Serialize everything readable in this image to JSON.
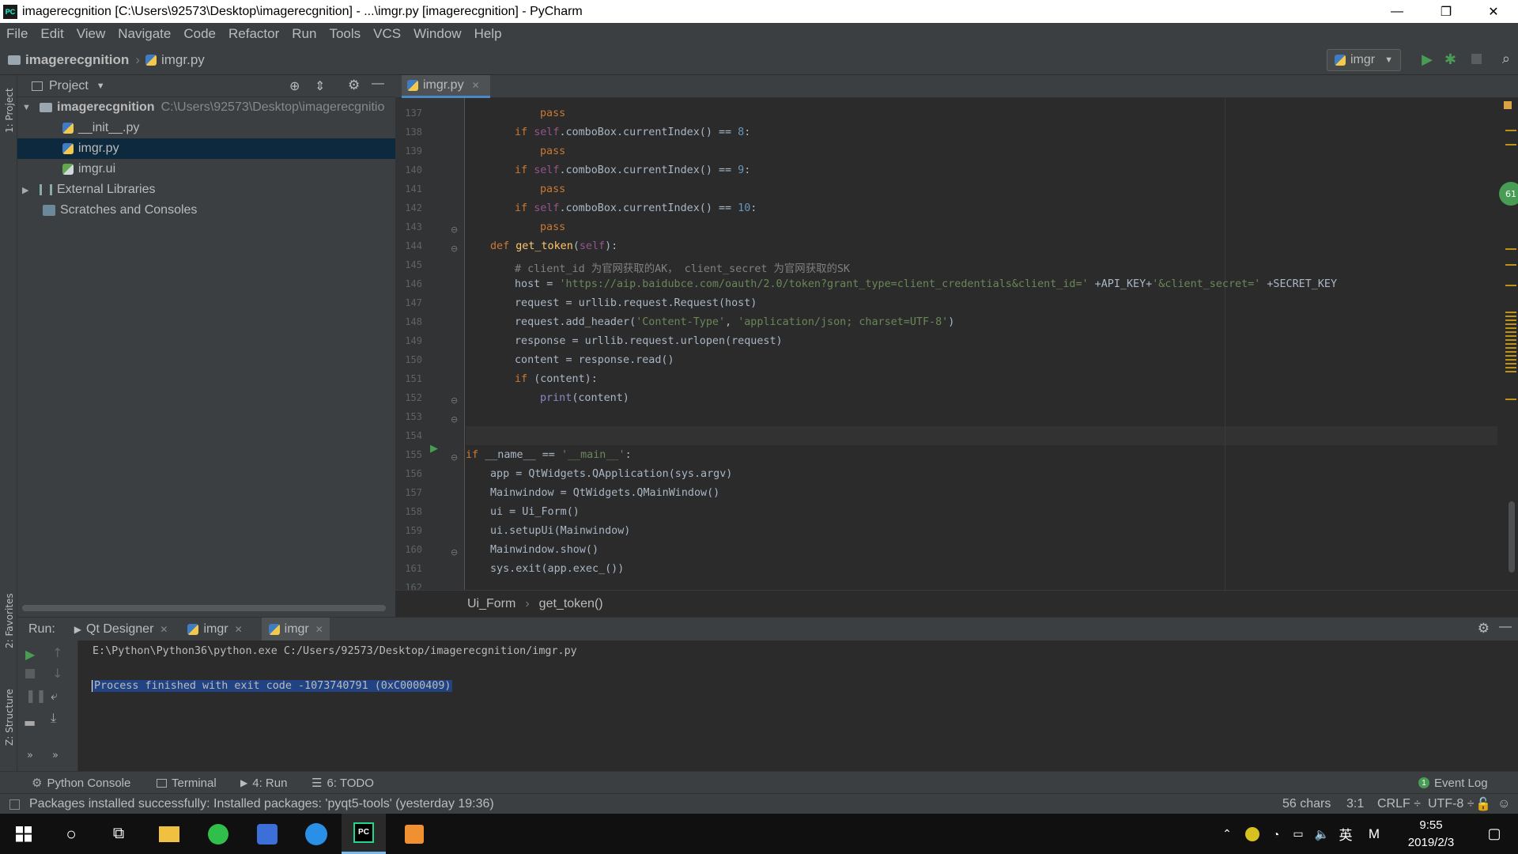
{
  "window": {
    "title": "imagerecgnition [C:\\Users\\92573\\Desktop\\imagerecgnition] - ...\\imgr.py [imagerecgnition] - PyCharm",
    "app_icon": "PC",
    "minimize": "—",
    "maximize": "❐",
    "close": "✕"
  },
  "menu": [
    "File",
    "Edit",
    "View",
    "Navigate",
    "Code",
    "Refactor",
    "Run",
    "Tools",
    "VCS",
    "Window",
    "Help"
  ],
  "navbar": {
    "project": "imagerecgnition",
    "file": "imgr.py",
    "run_config": "imgr"
  },
  "left_stripe": {
    "project": "1: Project",
    "favorites": "2: Favorites",
    "structure": "Z: Structure"
  },
  "project_panel": {
    "title": "Project",
    "root": {
      "name": "imagerecgnition",
      "path": "C:\\Users\\92573\\Desktop\\imagerecgnitio"
    },
    "files": [
      "__init__.py",
      "imgr.py",
      "imgr.ui"
    ],
    "external": "External Libraries",
    "scratches": "Scratches and Consoles"
  },
  "editor": {
    "tab": "imgr.py",
    "line_numbers": [
      "137",
      "138",
      "139",
      "140",
      "141",
      "142",
      "143",
      "144",
      "145",
      "146",
      "147",
      "148",
      "149",
      "150",
      "151",
      "152",
      "153",
      "154",
      "155",
      "156",
      "157",
      "158",
      "159",
      "160",
      "161",
      "162"
    ],
    "breadcrumb": [
      "Ui_Form",
      "get_token()"
    ],
    "inspection_badge": "61"
  },
  "code": {
    "l137": "pass",
    "l138_pre": "if ",
    "l138_self": "self",
    "l138_mid": ".comboBox.currentIndex() == ",
    "l138_num": "8",
    "l138_end": ":",
    "l139": "pass",
    "l140_pre": "if ",
    "l140_self": "self",
    "l140_mid": ".comboBox.currentIndex() == ",
    "l140_num": "9",
    "l140_end": ":",
    "l141": "pass",
    "l142_pre": "if ",
    "l142_self": "self",
    "l142_mid": ".comboBox.currentIndex() == ",
    "l142_num": "10",
    "l142_end": ":",
    "l143": "pass",
    "l144_def": "def ",
    "l144_fn": "get_token",
    "l144_open": "(",
    "l144_self": "self",
    "l144_close": "):",
    "l145": "# client_id 为官网获取的AK， client_secret 为官网获取的SK",
    "l146_pre": "host = ",
    "l146_str1": "'https://aip.baidubce.com/oauth/2.0/token?grant_type=client_credentials&client_id='",
    "l146_mid": " +API_KEY+",
    "l146_str2": "'&client_secret='",
    "l146_end": " +SECRET_KEY",
    "l147": "request = urllib.request.Request(host)",
    "l148_pre": "request.add_header(",
    "l148_s1": "'Content-Type'",
    "l148_c": ", ",
    "l148_s2": "'application/json; charset=UTF-8'",
    "l148_end": ")",
    "l149": "response = urllib.request.urlopen(request)",
    "l150": "content = response.read()",
    "l151_kw": "if ",
    "l151_rest": "(content):",
    "l152_bi": "print",
    "l152_rest": "(content)",
    "l155_kw": "if ",
    "l155_mid": "__name__ == ",
    "l155_str": "'__main__'",
    "l155_end": ":",
    "l156": "app = QtWidgets.QApplication(sys.argv)",
    "l157": "Mainwindow = QtWidgets.QMainWindow()",
    "l158": "ui = Ui_Form()",
    "l159": "ui.setupUi(Mainwindow)",
    "l160": "Mainwindow.show()",
    "l161": "sys.exit(app.exec_())"
  },
  "run_panel": {
    "label": "Run:",
    "tabs": [
      "Qt Designer",
      "imgr",
      "imgr"
    ],
    "command": "E:\\Python\\Python36\\python.exe C:/Users/92573/Desktop/imagerecgnition/imgr.py",
    "result": "Process finished with exit code -1073740791 (0xC0000409)"
  },
  "bottom_tabs": {
    "python_console": "Python Console",
    "terminal": "Terminal",
    "run": "4: Run",
    "todo": "6: TODO",
    "event_log": "Event Log",
    "event_count": "1"
  },
  "status": {
    "message": "Packages installed successfully: Installed packages: 'pyqt5-tools' (yesterday 19:36)",
    "chars": "56 chars",
    "position": "3:1",
    "line_sep": "CRLF ÷",
    "encoding": "UTF-8 ÷"
  },
  "taskbar": {
    "ime": "英",
    "ime2": "M",
    "time": "9:55",
    "date": "2019/2/3"
  },
  "colors": {
    "accent": "#4a88c7",
    "selection": "#214283",
    "keyword": "#cc7832",
    "string": "#6a8759"
  }
}
